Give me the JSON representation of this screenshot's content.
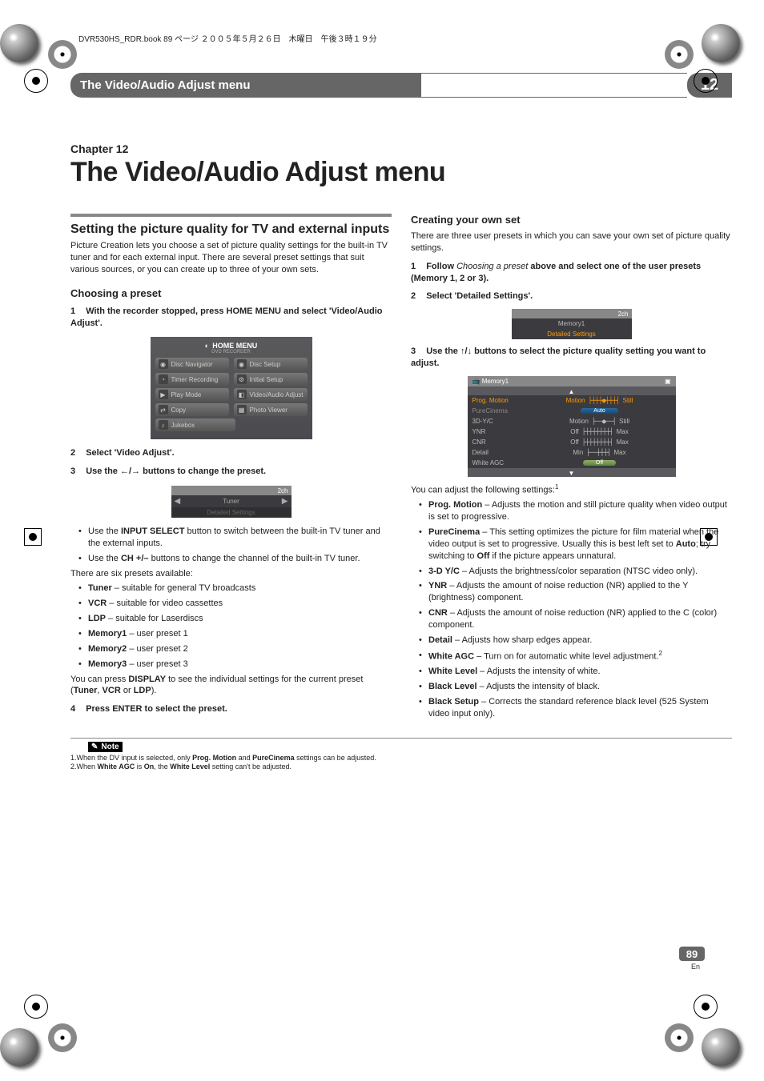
{
  "bookline": "DVR530HS_RDR.book  89 ページ  ２００５年５月２６日　木曜日　午後３時１９分",
  "header": {
    "title": "The Video/Audio Adjust menu",
    "num": "12"
  },
  "chapter": {
    "label": "Chapter 12",
    "title": "The Video/Audio Adjust menu"
  },
  "left": {
    "sec1": {
      "h": "Setting the picture quality for TV and external inputs",
      "p": "Picture Creation lets you choose a set of picture quality settings for the built-in TV tuner and for each external input. There are several preset settings that suit various sources, or you can create up to three of your own sets."
    },
    "sec2": {
      "h": "Choosing a preset",
      "step1_num": "1",
      "step1_a": "With the recorder stopped, press ",
      "step1_b": "HOME MENU",
      "step1_c": " and select 'Video/Audio Adjust'.",
      "home": {
        "title": "HOME MENU",
        "sub": "DVD RECORDER",
        "items": [
          "Disc Navigator",
          "Disc Setup",
          "Timer Recording",
          "Initial Setup",
          "Play Mode",
          "Video/Audio Adjust",
          "Copy",
          "Photo Viewer",
          "Jukebox"
        ]
      },
      "step2_num": "2",
      "step2": "Select 'Video Adjust'.",
      "step3_num": "3",
      "step3_a": "Use the ",
      "step3_b": " buttons to change the preset.",
      "preset_ui": {
        "ch": "2ch",
        "value": "Tuner",
        "detail": "Detailed Settings"
      },
      "bul1_a": "Use the ",
      "bul1_b": "INPUT SELECT",
      "bul1_c": " button to switch between the built-in TV tuner and the external inputs.",
      "bul2_a": "Use the ",
      "bul2_b": "CH +/–",
      "bul2_c": " buttons to change the channel of the built-in TV tuner.",
      "p2": "There are six presets available:",
      "presets": [
        {
          "b": "Tuner",
          "t": " – suitable for general TV broadcasts"
        },
        {
          "b": "VCR",
          "t": " – suitable for video cassettes"
        },
        {
          "b": "LDP",
          "t": " – suitable for Laserdiscs"
        },
        {
          "b": "Memory1",
          "t": " – user preset 1"
        },
        {
          "b": "Memory2",
          "t": " – user preset 2"
        },
        {
          "b": "Memory3",
          "t": " – user preset 3"
        }
      ],
      "p3_a": "You can press ",
      "p3_b": "DISPLAY",
      "p3_c": " to see the individual settings for the current preset (",
      "p3_d": "Tuner",
      "p3_e": ", ",
      "p3_f": "VCR",
      "p3_g": " or ",
      "p3_h": "LDP",
      "p3_i": ").",
      "step4_num": "4",
      "step4": "Press ENTER to select the preset."
    }
  },
  "right": {
    "sec": {
      "h": "Creating your own set",
      "p": "There are three user presets in which you can save your own set of picture quality settings.",
      "step1_num": "1",
      "step1_a": "Follow ",
      "step1_b": "Choosing a preset",
      "step1_c": " above and select one of the user presets (Memory 1, 2 or 3).",
      "step2_num": "2",
      "step2": "Select 'Detailed Settings'.",
      "mem_ui": {
        "ch": "2ch",
        "value": "Memory1",
        "detail": "Detailed Settings"
      },
      "step3_num": "3",
      "step3_a": "Use the ",
      "step3_b": " buttons to select the picture quality setting you want to adjust.",
      "memory_panel": {
        "title": "Memory1",
        "rows": [
          {
            "lab": "Prog. Motion",
            "l": "Motion",
            "r": "Still",
            "style": "scale",
            "sel": true
          },
          {
            "lab": "PureCinema",
            "val": "Auto",
            "style": "btn"
          },
          {
            "lab": "3D-Y/C",
            "l": "Motion",
            "r": "Still",
            "style": "scale"
          },
          {
            "lab": "YNR",
            "l": "Off",
            "r": "Max",
            "style": "scale"
          },
          {
            "lab": "CNR",
            "l": "Off",
            "r": "Max",
            "style": "scale"
          },
          {
            "lab": "Detail",
            "l": "Min",
            "r": "Max",
            "style": "scale"
          },
          {
            "lab": "White AGC",
            "val": "Off",
            "style": "btn"
          }
        ]
      },
      "p2_a": "You can adjust the following settings:",
      "p2_sup": "1",
      "items": [
        {
          "b": "Prog. Motion",
          "t": " – Adjusts the motion and still picture quality when video output is set to progressive."
        },
        {
          "b": "PureCinema",
          "t": " –  This setting optimizes the picture for film material when the video output is set to progressive. Usually this is best left set to ",
          "b2": "Auto",
          "t2": "; try switching to ",
          "b3": "Off",
          "t3": " if the picture appears unnatural."
        },
        {
          "b": "3-D Y/C",
          "t": " – Adjusts the brightness/color separation (NTSC video only)."
        },
        {
          "b": "YNR",
          "t": " – Adjusts the amount of noise reduction (NR) applied to the Y (brightness) component."
        },
        {
          "b": "CNR",
          "t": " – Adjusts the amount of noise reduction (NR) applied to the C (color) component."
        },
        {
          "b": "Detail",
          "t": " – Adjusts how sharp edges appear."
        },
        {
          "b": "White AGC",
          "t": " – Turn on for automatic white level adjustment.",
          "sup": "2"
        },
        {
          "b": "White Level",
          "t": " – Adjusts the intensity of white."
        },
        {
          "b": "Black Level",
          "t": " – Adjusts the intensity of black."
        },
        {
          "b": "Black Setup",
          "t": " – Corrects the standard reference black level (525 System video input only)."
        }
      ]
    }
  },
  "footnotes": {
    "note_label": "Note",
    "f1_a": "1.When the DV input is selected, only ",
    "f1_b": "Prog. Motion",
    "f1_c": " and ",
    "f1_d": "PureCinema",
    "f1_e": " settings can be adjusted.",
    "f2_a": "2.When ",
    "f2_b": "White AGC",
    "f2_c": " is ",
    "f2_d": "On",
    "f2_e": ", the ",
    "f2_f": "White Level",
    "f2_g": " setting can't be adjusted."
  },
  "page": {
    "num": "89",
    "lang": "En"
  }
}
